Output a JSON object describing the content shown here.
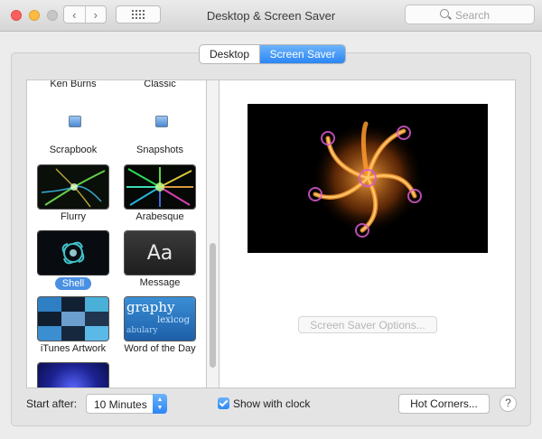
{
  "window": {
    "title": "Desktop & Screen Saver"
  },
  "toolbar": {
    "back_icon": "‹",
    "forward_icon": "›",
    "search_placeholder": "Search"
  },
  "tabs": [
    {
      "label": "Desktop"
    },
    {
      "label": "Screen Saver"
    }
  ],
  "screensavers": [
    {
      "label": "Ken Burns"
    },
    {
      "label": "Classic"
    },
    {
      "label": "Scrapbook"
    },
    {
      "label": "Snapshots"
    },
    {
      "label": "Flurry"
    },
    {
      "label": "Arabesque"
    },
    {
      "label": "Shell"
    },
    {
      "label": "Message",
      "thumb_text": "Aa"
    },
    {
      "label": "iTunes Artwork"
    },
    {
      "label": "Word of the Day",
      "thumb_text": [
        "graphy",
        "lexicog",
        "abulary"
      ]
    }
  ],
  "preview": {
    "options_button": "Screen Saver Options..."
  },
  "bottom": {
    "start_after_label": "Start after:",
    "start_after_value": "10 Minutes",
    "show_clock_label": "Show with clock",
    "hot_corners_button": "Hot Corners...",
    "help_icon": "?"
  },
  "colors": {
    "accent": "#2b86f5",
    "selected_badge": "#4a90e2"
  }
}
